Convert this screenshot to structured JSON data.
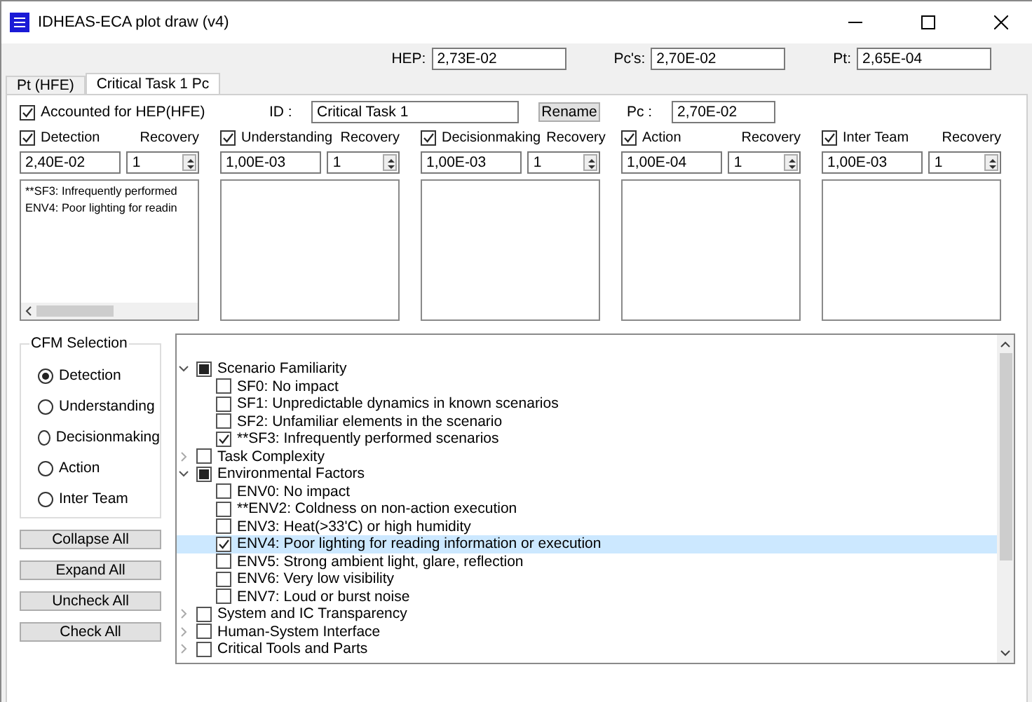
{
  "window": {
    "title": "IDHEAS-ECA plot draw (v4)"
  },
  "summary": [
    {
      "label": "HEP:",
      "value": "2,73E-02"
    },
    {
      "label": "Pc's:",
      "value": "2,70E-02"
    },
    {
      "label": "Pt:",
      "value": "2,65E-04"
    }
  ],
  "tabs": [
    {
      "label": "Pt (HFE)",
      "selected": false
    },
    {
      "label": "Critical Task 1 Pc",
      "selected": true
    }
  ],
  "task": {
    "accounted": {
      "label": "Accounted for HEP(HFE)",
      "checked": true
    },
    "id_label": "ID :",
    "id_value": "Critical Task 1",
    "rename": "Rename",
    "pc_label": "Pc :",
    "pc_value": "2,70E-02"
  },
  "cfms": [
    {
      "label": "Detection",
      "checked": true,
      "recovery_label": "Recovery",
      "value": "2,40E-02",
      "recovery": "1",
      "items": [
        "**SF3: Infrequently performed",
        "ENV4: Poor lighting for readin"
      ]
    },
    {
      "label": "Understanding",
      "checked": true,
      "recovery_label": "Recovery",
      "value": "1,00E-03",
      "recovery": "1"
    },
    {
      "label": "Decisionmaking",
      "checked": true,
      "recovery_label": "Recovery",
      "value": "1,00E-03",
      "recovery": "1"
    },
    {
      "label": "Action",
      "checked": true,
      "recovery_label": "Recovery",
      "value": "1,00E-04",
      "recovery": "1"
    },
    {
      "label": "Inter Team",
      "checked": true,
      "recovery_label": "Recovery",
      "value": "1,00E-03",
      "recovery": "1"
    }
  ],
  "cfm_selection": {
    "title": "CFM Selection",
    "options": [
      {
        "label": "Detection",
        "selected": true
      },
      {
        "label": "Understanding",
        "selected": false
      },
      {
        "label": "Decisionmaking",
        "selected": false
      },
      {
        "label": "Action",
        "selected": false
      },
      {
        "label": "Inter Team",
        "selected": false
      }
    ]
  },
  "buttons": [
    "Collapse All",
    "Expand All",
    "Uncheck All",
    "Check All"
  ],
  "tree": [
    {
      "label": "Scenario Familiarity",
      "expanded": true,
      "checked": false,
      "indeterminate": true,
      "selected": false,
      "children": [
        {
          "label": "SF0: No impact",
          "checked": false,
          "selected": false
        },
        {
          "label": "SF1: Unpredictable dynamics in known scenarios",
          "checked": false,
          "selected": false
        },
        {
          "label": "SF2: Unfamiliar elements in the scenario",
          "checked": false,
          "selected": false
        },
        {
          "label": "**SF3: Infrequently performed scenarios",
          "checked": true,
          "selected": false
        }
      ]
    },
    {
      "label": "Task Complexity",
      "expanded": false,
      "checked": false,
      "indeterminate": false,
      "selected": false
    },
    {
      "label": "Environmental Factors",
      "expanded": true,
      "checked": false,
      "indeterminate": true,
      "selected": false,
      "children": [
        {
          "label": "ENV0: No impact",
          "checked": false,
          "selected": false
        },
        {
          "label": "**ENV2: Coldness on non-action execution",
          "checked": false,
          "selected": false
        },
        {
          "label": "ENV3: Heat(>33'C) or high humidity",
          "checked": false,
          "selected": false
        },
        {
          "label": "ENV4: Poor lighting for reading information or execution",
          "checked": true,
          "selected": true
        },
        {
          "label": "ENV5: Strong ambient light, glare, reflection",
          "checked": false,
          "selected": false
        },
        {
          "label": "ENV6: Very low visibility",
          "checked": false,
          "selected": false
        },
        {
          "label": "ENV7: Loud or burst noise",
          "checked": false,
          "selected": false
        }
      ]
    },
    {
      "label": "System and IC Transparency",
      "expanded": false,
      "checked": false,
      "indeterminate": false,
      "selected": false
    },
    {
      "label": "Human-System Interface",
      "expanded": false,
      "checked": false,
      "indeterminate": false,
      "selected": false
    },
    {
      "label": "Critical Tools and Parts",
      "expanded": false,
      "checked": false,
      "indeterminate": false,
      "selected": false
    }
  ]
}
